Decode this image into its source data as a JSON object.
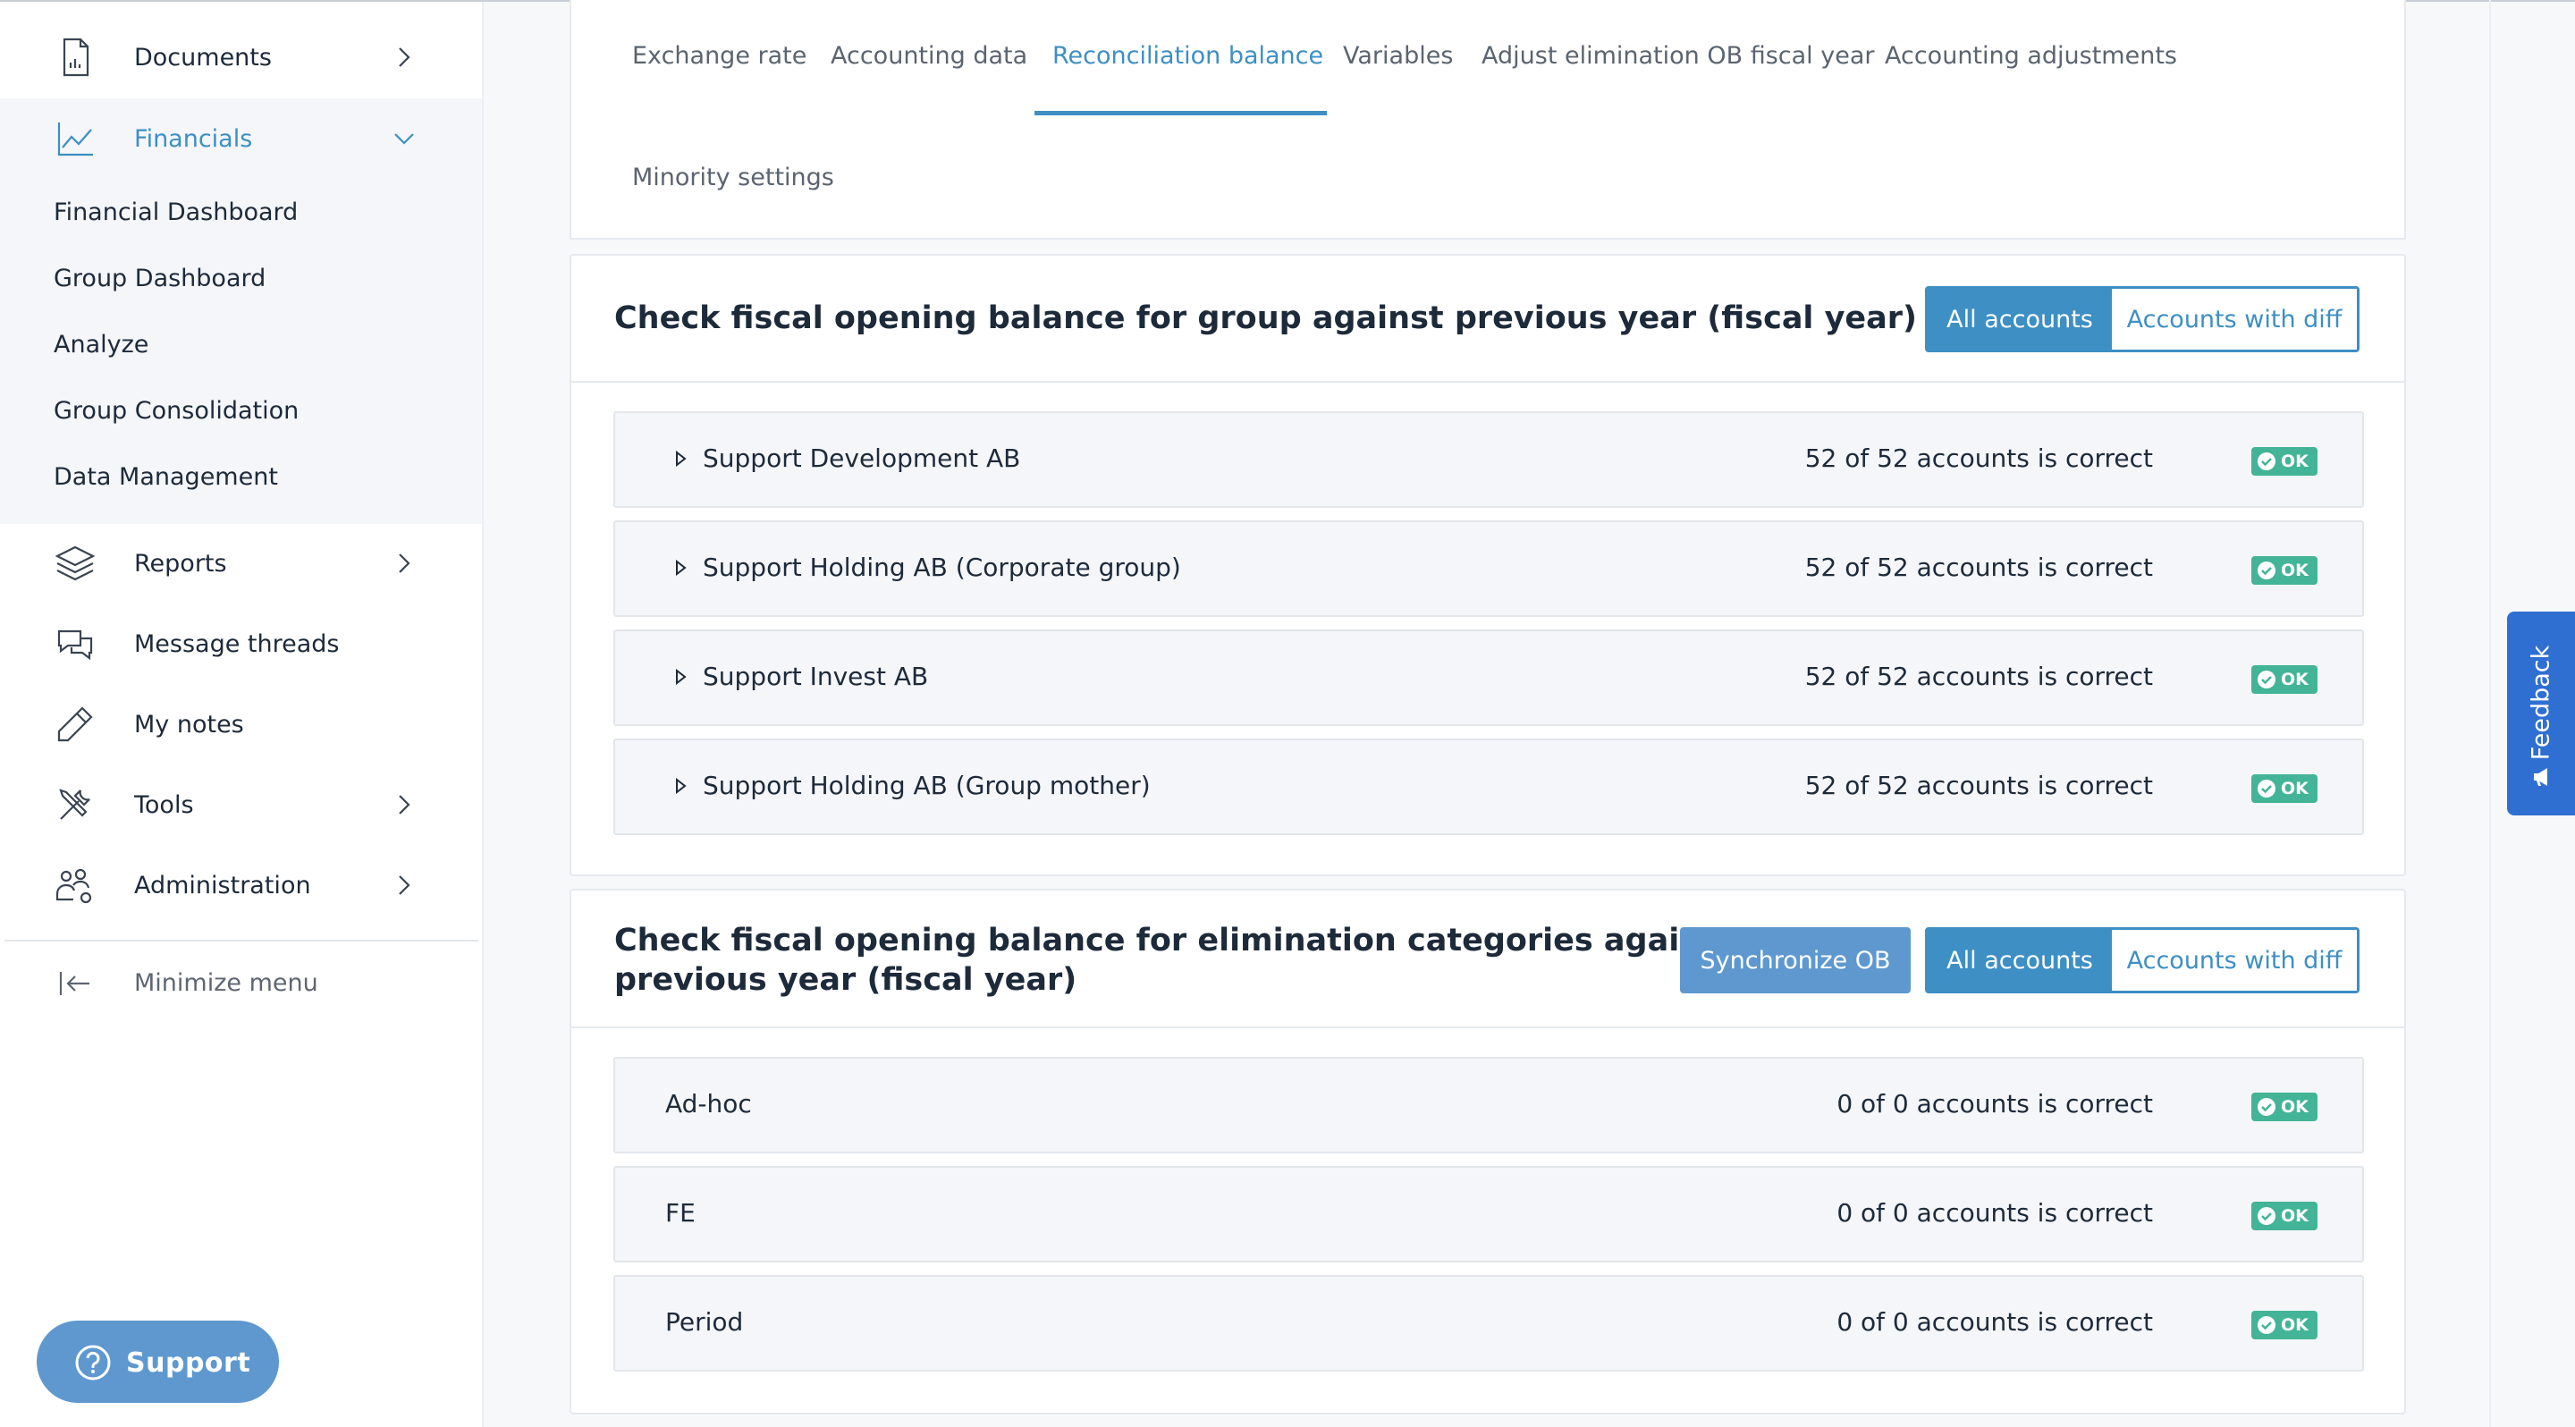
{
  "sidebar": {
    "documents": "Documents",
    "financials": "Financials",
    "sub_items": [
      "Financial Dashboard",
      "Group Dashboard",
      "Analyze",
      "Group Consolidation",
      "Data Management"
    ],
    "reports": "Reports",
    "message_threads": "Message threads",
    "my_notes": "My notes",
    "tools": "Tools",
    "administration": "Administration",
    "minimize": "Minimize menu",
    "support": "Support"
  },
  "tabs": [
    "Exchange rate",
    "Accounting data",
    "Reconciliation balance",
    "Variables",
    "Adjust elimination OB fiscal year",
    "Accounting adjustments",
    "Minority settings"
  ],
  "active_tab": "Reconciliation balance",
  "group_panel": {
    "title": "Check fiscal opening balance for group against previous year (fiscal year)",
    "filter_all": "All accounts",
    "filter_diff": "Accounts with diff",
    "rows": [
      {
        "name": "Support Development AB",
        "status": "52 of 52 accounts is correct",
        "badge": "OK"
      },
      {
        "name": "Support Holding AB (Corporate group)",
        "status": "52 of 52 accounts is correct",
        "badge": "OK"
      },
      {
        "name": "Support Invest AB",
        "status": "52 of 52 accounts is correct",
        "badge": "OK"
      },
      {
        "name": "Support Holding AB (Group mother)",
        "status": "52 of 52 accounts is correct",
        "badge": "OK"
      }
    ]
  },
  "elim_panel": {
    "title_line1": "Check fiscal opening balance for elimination categories against",
    "title_line2": "previous year (fiscal year)",
    "sync_label": "Synchronize OB",
    "filter_all": "All accounts",
    "filter_diff": "Accounts with diff",
    "rows": [
      {
        "name": "Ad-hoc",
        "status": "0 of 0 accounts is correct",
        "badge": "OK"
      },
      {
        "name": "FE",
        "status": "0 of 0 accounts is correct",
        "badge": "OK"
      },
      {
        "name": "Period",
        "status": "0 of 0 accounts is correct",
        "badge": "OK"
      }
    ]
  },
  "feedback_label": "Feedback",
  "colors": {
    "accent": "#3d8fc4",
    "button": "#5e98cf",
    "ok": "#43b497",
    "feedback": "#2f6fd1"
  },
  "icons": {
    "documents": "document-chart-icon",
    "financials": "line-chart-icon",
    "reports": "layers-icon",
    "message_threads": "chat-bubbles-icon",
    "my_notes": "pencil-icon",
    "tools": "tools-icon",
    "administration": "users-gear-icon",
    "minimize": "collapse-left-icon",
    "support": "question-circle-icon"
  }
}
